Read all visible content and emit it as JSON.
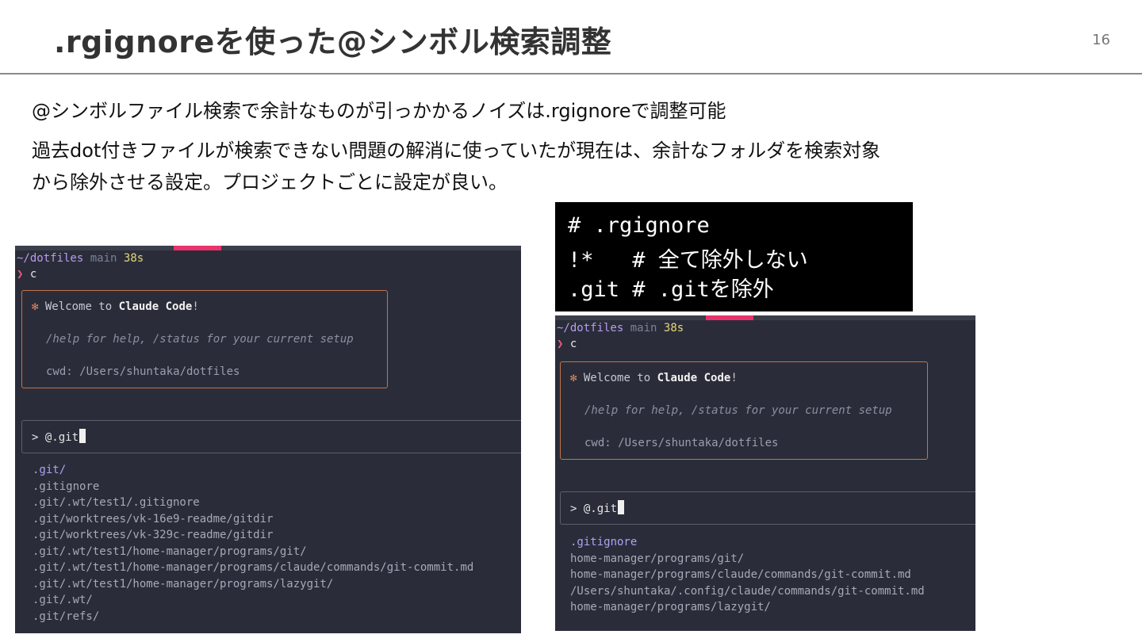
{
  "slide": {
    "title": ".rgignoreを使った@シンボル検索調整",
    "page_number": "16",
    "lead": "@シンボルファイル検索で余計なものが引っかかるノイズは.rgignoreで調整可能",
    "body_line1": "過去dot付きファイルが検索できない問題の解消に使っていたが現在は、余計なフォルダを検索対象",
    "body_line2": "から除外させる設定。プロジェクトごとに設定が良い。"
  },
  "code": {
    "line1": "# .rgignore",
    "line2": "!*   # 全て除外しない",
    "line3": ".git # .gitを除外"
  },
  "term_left": {
    "prompt_path": "~/dotfiles",
    "prompt_branch": "main",
    "prompt_duration": "38s",
    "prompt_arrow": "❯",
    "command": "c",
    "welcome_star": "✻",
    "welcome_prefix": "Welcome to ",
    "welcome_product": "Claude Code",
    "welcome_suffix": "!",
    "help_text": "/help for help, /status for your current setup",
    "cwd_text": "cwd: /Users/shuntaka/dotfiles",
    "input_text": "> @.git",
    "results": [
      ".git/",
      ".gitignore",
      ".git/.wt/test1/.gitignore",
      ".git/worktrees/vk-16e9-readme/gitdir",
      ".git/worktrees/vk-329c-readme/gitdir",
      ".git/.wt/test1/home-manager/programs/git/",
      ".git/.wt/test1/home-manager/programs/claude/commands/git-commit.md",
      ".git/.wt/test1/home-manager/programs/lazygit/",
      ".git/.wt/",
      ".git/refs/"
    ]
  },
  "term_right": {
    "prompt_path": "~/dotfiles",
    "prompt_branch": "main",
    "prompt_duration": "38s",
    "prompt_arrow": "❯",
    "command": "c",
    "welcome_star": "✻",
    "welcome_prefix": "Welcome to ",
    "welcome_product": "Claude Code",
    "welcome_suffix": "!",
    "help_text": "/help for help, /status for your current setup",
    "cwd_text": "cwd: /Users/shuntaka/dotfiles",
    "input_text": "> @.git",
    "results": [
      ".gitignore",
      "home-manager/programs/git/",
      "home-manager/programs/claude/commands/git-commit.md",
      "/Users/shuntaka/.config/claude/commands/git-commit.md",
      "home-manager/programs/lazygit/"
    ]
  }
}
